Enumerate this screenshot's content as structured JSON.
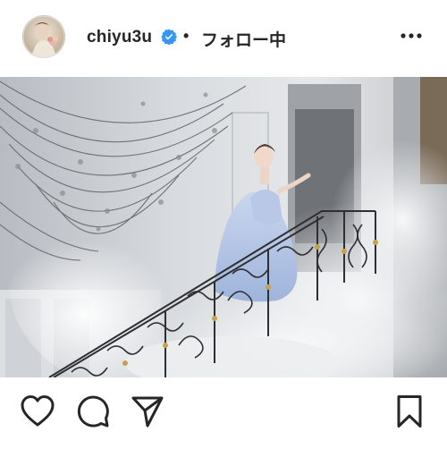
{
  "post": {
    "username": "chiyu3u",
    "separator": "•",
    "follow_label": "フォロー中"
  },
  "icons": {
    "verified": "verified-badge-icon",
    "more": "more-options-icon",
    "like": "heart-icon",
    "comment": "comment-icon",
    "share": "share-icon",
    "save": "bookmark-icon"
  },
  "colors": {
    "text": "#262626",
    "verified": "#3897f0",
    "background": "#ffffff"
  }
}
